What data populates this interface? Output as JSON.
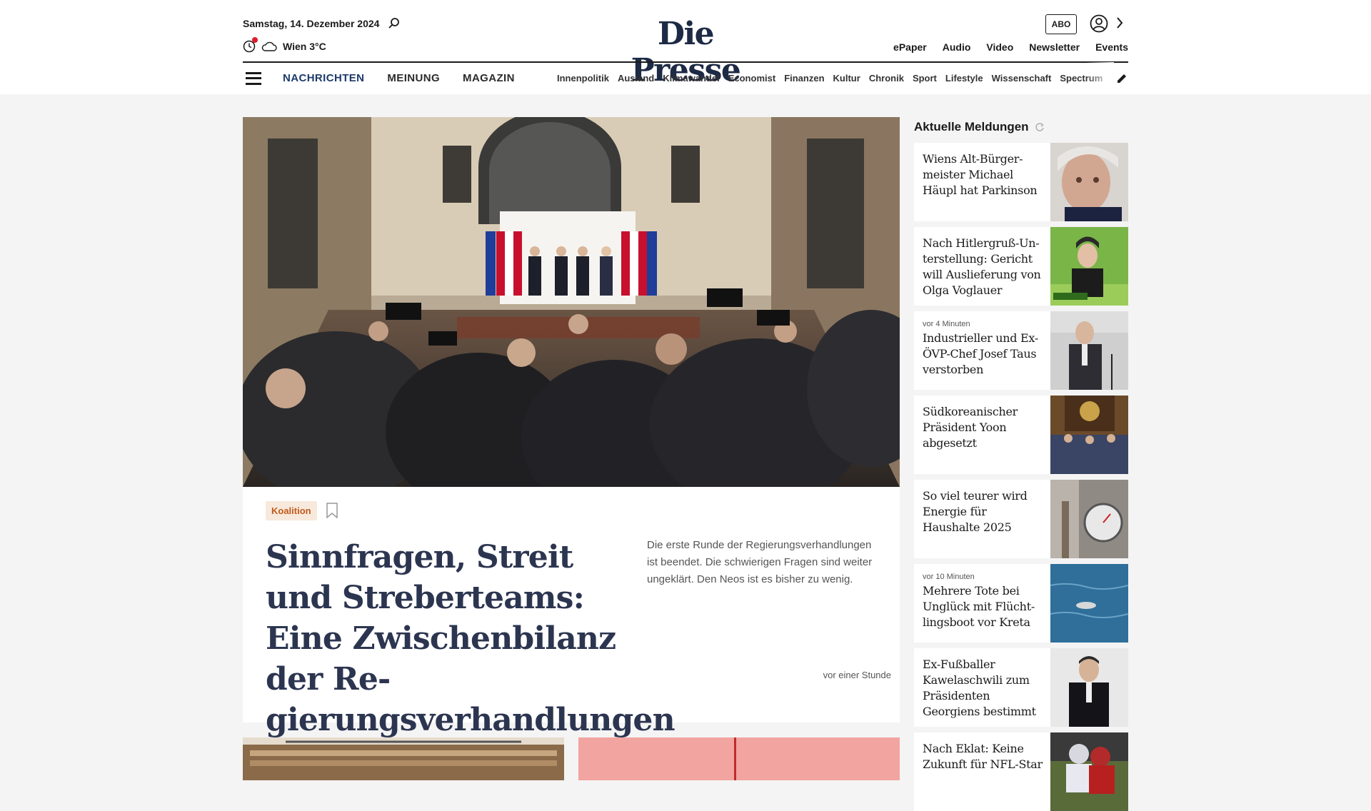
{
  "header": {
    "date": "Samstag, 14. Dezember 2024",
    "weather": "Wien 3°C",
    "logo": "Die Presse",
    "abo_label": "ABO",
    "top_links": [
      "ePaper",
      "Audio",
      "Video",
      "Newsletter",
      "Events"
    ],
    "main_nav": [
      "NACHRICHTEN",
      "MEINUNG",
      "MAGAZIN"
    ],
    "sub_nav": [
      "Innenpolitik",
      "Ausland",
      "Klimawandel",
      "Economist",
      "Finanzen",
      "Kultur",
      "Chronik",
      "Sport",
      "Lifestyle",
      "Wissenschaft",
      "Spectrum"
    ]
  },
  "hero": {
    "tag": "Koalition",
    "headline": "Sinnfragen, Streit und Streberteams: Eine Zwischenbilanz der Re-gierungsverhandlungen",
    "teaser": "Die erste Runde der Regierungsverhandlungen ist beendet. Die schwierigen Fragen sind weiter ungeklärt. Den Neos ist es bisher zu wenig.",
    "timestamp": "vor einer Stunde"
  },
  "sidebar": {
    "title": "Aktuelle Meldungen",
    "items": [
      {
        "time": "",
        "headline": "Wiens Alt-Bürger-meister Michael Häupl hat Parkinson"
      },
      {
        "time": "",
        "headline": "Nach Hitlergruß-Un-terstellung: Gericht will Auslieferung von Olga Voglauer"
      },
      {
        "time": "vor 4 Minuten",
        "headline": "Industrieller und Ex-ÖVP-Chef Josef Taus verstorben"
      },
      {
        "time": "",
        "headline": "Südkoreanischer Präsident Yoon abgesetzt"
      },
      {
        "time": "",
        "headline": "So viel teurer wird Energie für Haushalte 2025"
      },
      {
        "time": "vor 10 Minuten",
        "headline": "Mehrere Tote bei Unglück mit Flücht-lingsboot vor Kreta"
      },
      {
        "time": "",
        "headline": "Ex-Fußballer Kawelaschwili zum Präsidenten Georgiens bestimmt"
      },
      {
        "time": "",
        "headline": "Nach Eklat: Keine Zukunft für NFL-Star"
      }
    ]
  }
}
